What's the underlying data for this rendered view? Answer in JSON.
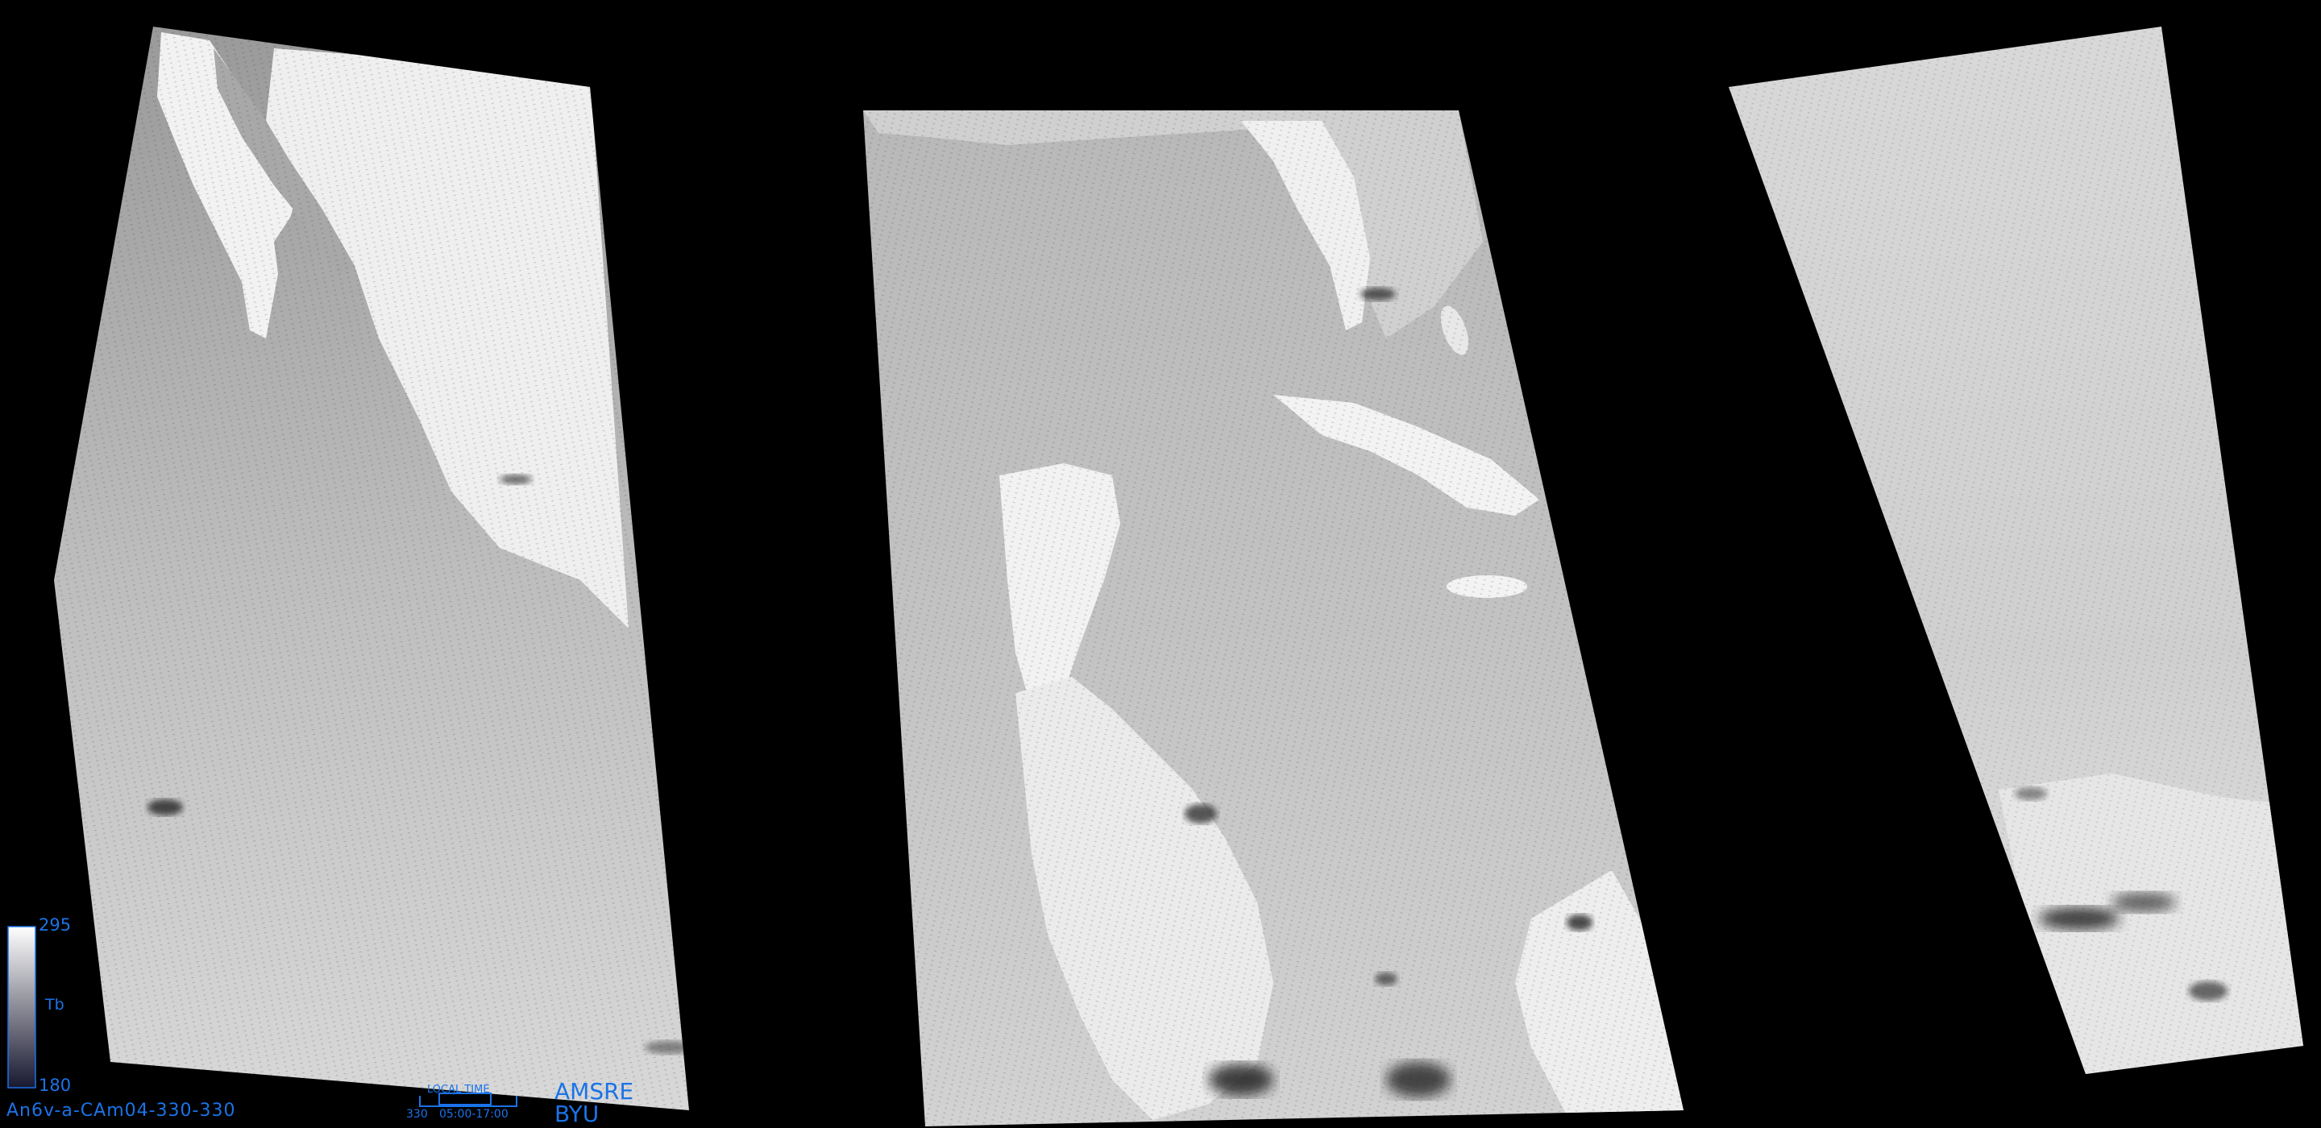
{
  "scale": {
    "max": "295",
    "unit": "Tb",
    "min": "180"
  },
  "image_id": "An6v-a-CAm04-330-330",
  "time_scale": {
    "title": "LOCAL TIME",
    "start": "330",
    "range": "05:00-17:00"
  },
  "sensor": "AMSRE",
  "institution": "BYU"
}
